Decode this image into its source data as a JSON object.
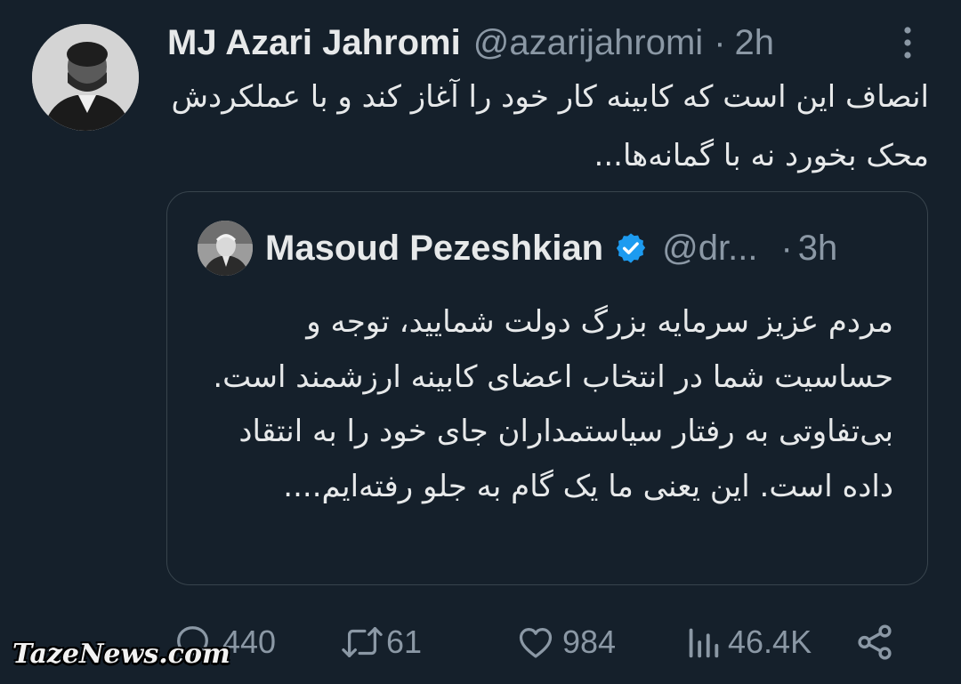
{
  "tweet": {
    "author_name": "MJ Azari Jahromi",
    "author_handle": "@azarijahromi",
    "separator": "·",
    "time": "2h",
    "text": "انصاف این است که کابینه کار خود را آغاز کند و با عملکردش محک بخورد نه با گمانه‌ها..."
  },
  "quote": {
    "author_name": "Masoud Pezeshkian",
    "author_handle": "@dr...",
    "separator": "·",
    "time": "3h",
    "verified": true,
    "text": "مردم عزیز سرمایه بزرگ دولت شمایید، توجه و حساسیت شما در انتخاب اعضای کابینه ارزشمند است. بی‌تفاوتی به رفتار سیاستمداران جای خود را به انتقاد داده است. این یعنی ما یک گام به جلو رفته‌ایم...."
  },
  "actions": {
    "replies": "440",
    "retweets": "61",
    "likes": "984",
    "views": "46.4K"
  },
  "icons": [
    "more-icon",
    "verified-badge-icon",
    "reply-icon",
    "retweet-icon",
    "like-icon",
    "views-icon",
    "share-icon"
  ],
  "colors": {
    "background": "#15202b",
    "text": "#e7e9ea",
    "secondary_text": "#8b98a5",
    "border": "#38444d",
    "verified": "#1d9bf0"
  },
  "watermark": "TazeNews.com"
}
